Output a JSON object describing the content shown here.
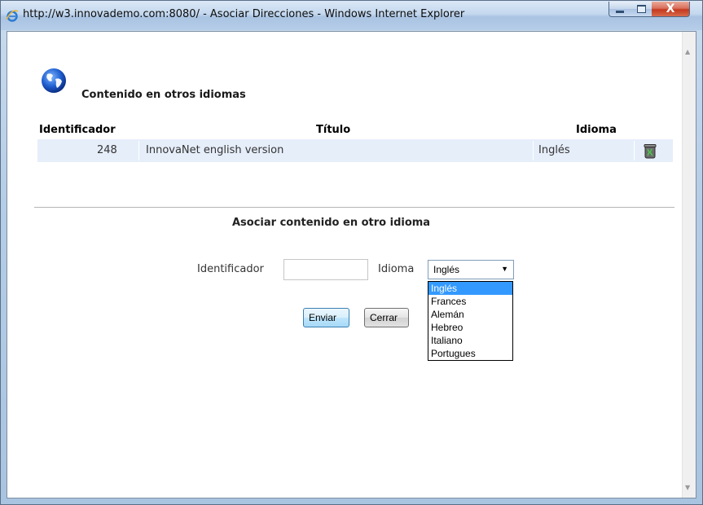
{
  "window": {
    "title": "http://w3.innovademo.com:8080/ - Asociar Direcciones - Windows Internet Explorer",
    "close_glyph": "X"
  },
  "section": {
    "heading": "Contenido en otros idiomas",
    "icon": "globe-icon"
  },
  "table": {
    "headers": {
      "id": "Identificador",
      "title": "Título",
      "language": "Idioma"
    },
    "rows": [
      {
        "id": "248",
        "title": "InnovaNet english version",
        "language": "Inglés",
        "action_icon": "trash-icon"
      }
    ]
  },
  "form": {
    "heading": "Asociar contenido en otro idioma",
    "id_label": "Identificador",
    "id_value": "",
    "language_label": "Idioma",
    "language_selected": "Inglés",
    "language_options": [
      "Inglés",
      "Frances",
      "Alemán",
      "Hebreo",
      "Italiano",
      "Portugues"
    ],
    "send_label": "Enviar",
    "close_label": "Cerrar"
  },
  "colors": {
    "row_background": "#e6eefa",
    "selection_highlight": "#3399ff",
    "close_button": "#c4391e"
  }
}
